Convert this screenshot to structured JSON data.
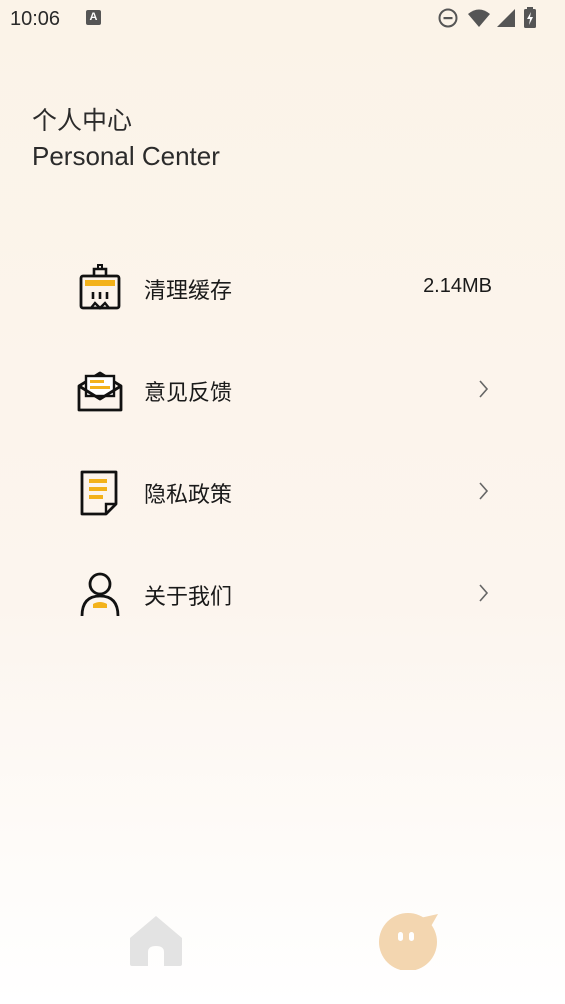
{
  "status_bar": {
    "time": "10:06",
    "notification_letter": "A"
  },
  "header": {
    "title_cn": "个人中心",
    "title_en": "Personal Center"
  },
  "menu": [
    {
      "label": "清理缓存",
      "value": "2.14MB",
      "icon": "cache-building-icon"
    },
    {
      "label": "意见反馈",
      "icon": "envelope-icon"
    },
    {
      "label": "隐私政策",
      "icon": "document-icon"
    },
    {
      "label": "关于我们",
      "icon": "person-icon"
    }
  ],
  "tabbar": {
    "tabs": [
      {
        "name": "home",
        "icon": "home-icon",
        "active": false
      },
      {
        "name": "me",
        "icon": "chat-face-icon",
        "active": true
      }
    ]
  },
  "colors": {
    "accent": "#f3b21a",
    "tab_active": "#f3d6b0",
    "tab_inactive": "#e3e3e3"
  }
}
